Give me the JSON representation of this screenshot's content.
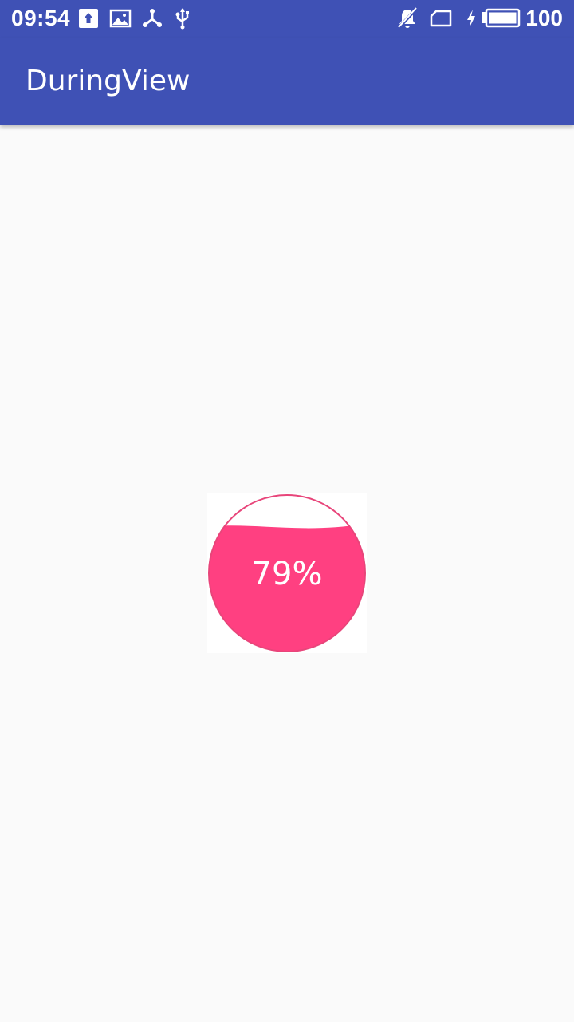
{
  "status_bar": {
    "time": "09:54",
    "battery_level": "100",
    "icons": [
      "upload-icon",
      "image-icon",
      "share-icon",
      "usb-icon",
      "notifications-off-icon",
      "sim-card-icon",
      "charging-bolt-icon",
      "battery-icon"
    ]
  },
  "app_bar": {
    "title": "DuringView"
  },
  "during_view": {
    "progress_percent": 79,
    "label": "79%",
    "fill_color": "#ff4081",
    "text_color": "#ffffff"
  },
  "colors": {
    "primary": "#3f51b5",
    "accent": "#ff4081",
    "background": "#fafafa"
  }
}
